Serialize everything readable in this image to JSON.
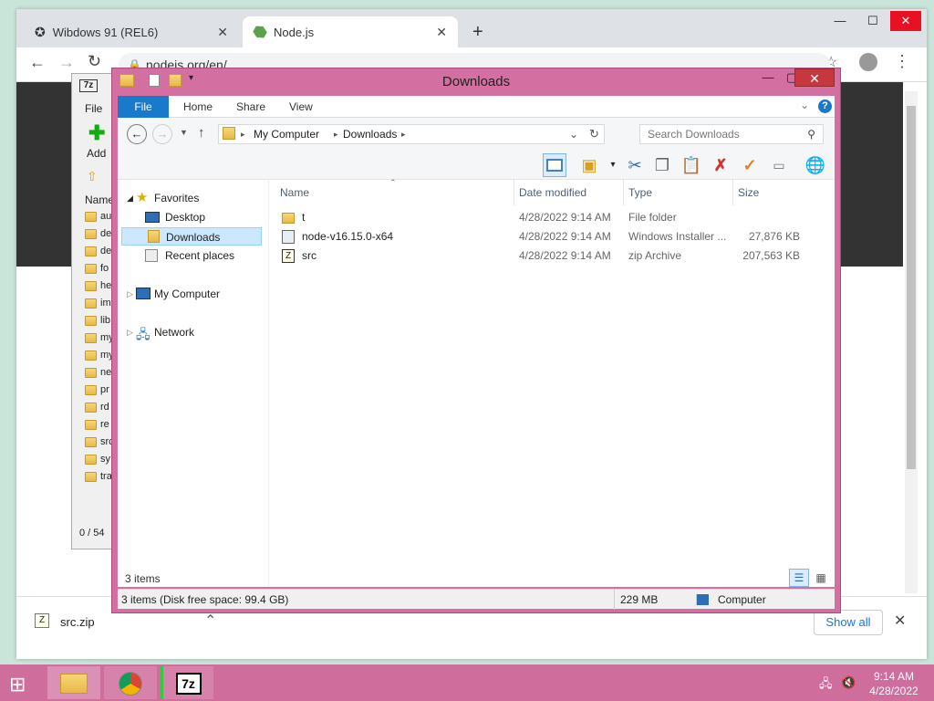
{
  "chrome": {
    "tabs": [
      {
        "label": "Wibdows 91 (REL6)",
        "active": false
      },
      {
        "label": "Node.js",
        "active": true
      }
    ],
    "url": "nodejs.org/en/",
    "download": {
      "filename": "src.zip",
      "show_all": "Show all"
    }
  },
  "sevenzip": {
    "menu_file": "File",
    "add_label": "Add",
    "col_name": "Name",
    "rows": [
      "au",
      "de",
      "de",
      "fo",
      "he",
      "im",
      "lib",
      "my",
      "my",
      "ne",
      "pr",
      "rd",
      "re",
      "src",
      "sy",
      "tra"
    ],
    "status": "0 / 54 "
  },
  "explorer": {
    "title": "Downloads",
    "ribbon_tabs": [
      "File",
      "Home",
      "Share",
      "View"
    ],
    "breadcrumb": [
      "My Computer",
      "Downloads"
    ],
    "search_placeholder": "Search Downloads",
    "nav": {
      "favorites": "Favorites",
      "desktop": "Desktop",
      "downloads": "Downloads",
      "recent": "Recent places",
      "computer": "My Computer",
      "network": "Network"
    },
    "columns": {
      "name": "Name",
      "date": "Date modified",
      "type": "Type",
      "size": "Size"
    },
    "files": [
      {
        "name": "t",
        "date": "4/28/2022 9:14 AM",
        "type": "File folder",
        "size": ""
      },
      {
        "name": "node-v16.15.0-x64",
        "date": "4/28/2022 9:14 AM",
        "type": "Windows Installer ...",
        "size": "27,876 KB"
      },
      {
        "name": "src",
        "date": "4/28/2022 9:14 AM",
        "type": "zip Archive",
        "size": "207,563 KB"
      }
    ],
    "item_count": "3 items",
    "status_left": "3 items (Disk free space: 99.4 GB)",
    "status_size": "229 MB",
    "status_location": "Computer"
  },
  "taskbar": {
    "time": "9:14 AM",
    "date": "4/28/2022",
    "sevenzip_label": "7z"
  },
  "colors": {
    "accent": "#1979ca",
    "explorer_frame": "#d46fa2",
    "taskbar": "#cf6d9d",
    "close_red": "#c7373e"
  }
}
